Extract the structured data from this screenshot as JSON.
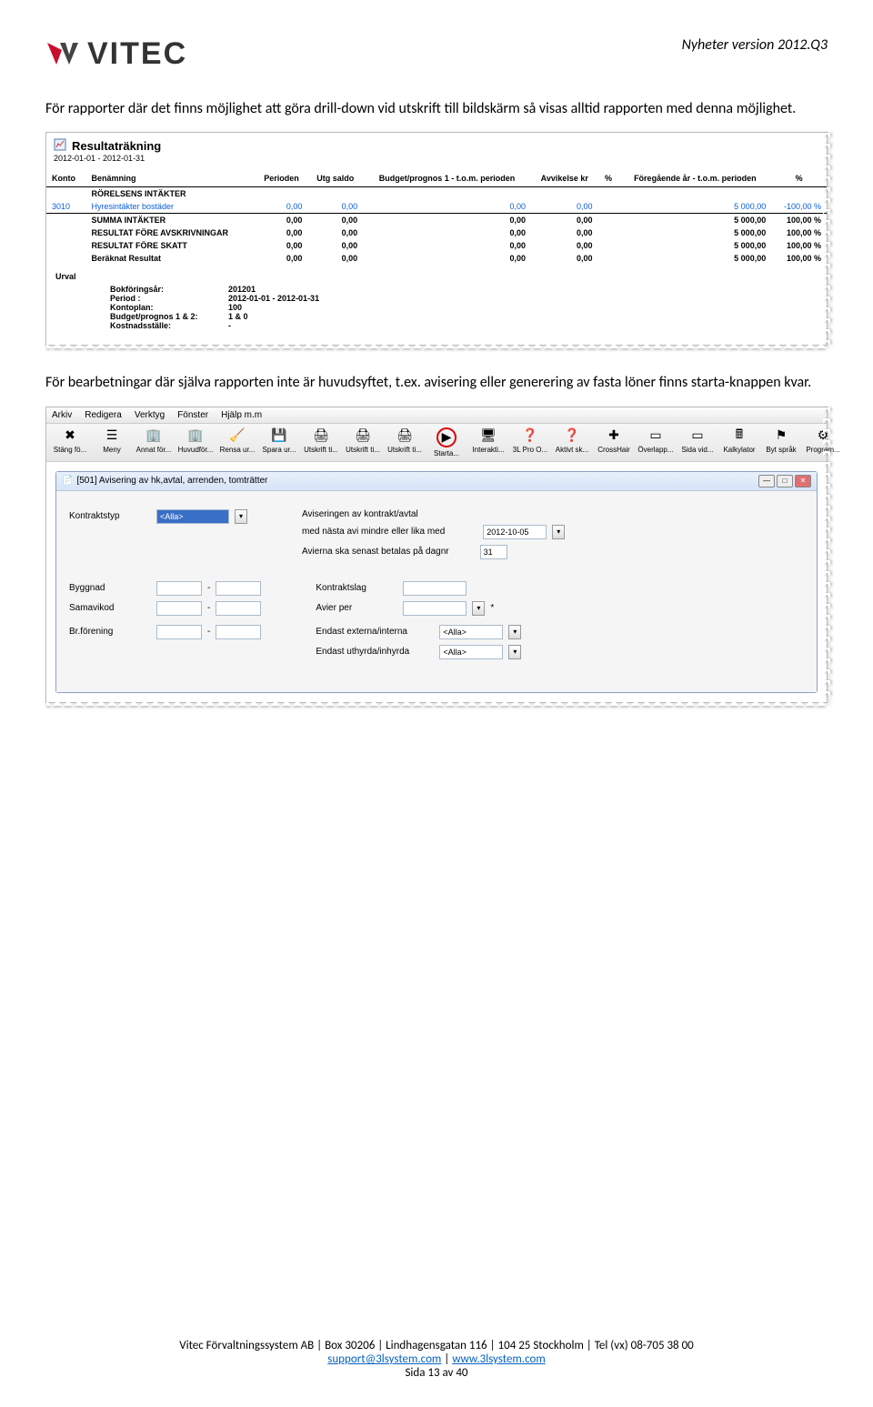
{
  "header": {
    "logo_text": "VITEC",
    "version": "Nyheter version 2012.Q3"
  },
  "para1": "För rapporter där det finns möjlighet att göra drill-down vid utskrift till bildskärm så visas alltid rapporten med denna möjlighet.",
  "para2": "För bearbetningar där själva rapporten inte är huvudsyftet, t.ex. avisering eller generering av fasta löner finns starta-knappen kvar.",
  "report": {
    "title": "Resultaträkning",
    "daterange": "2012-01-01 - 2012-01-31",
    "columns": [
      "Konto",
      "Benämning",
      "Perioden",
      "Utg saldo",
      "Budget/prognos 1 - t.o.m. perioden",
      "Avvikelse kr",
      "%",
      "Föregående år - t.o.m. perioden",
      "%"
    ],
    "section": "RÖRELSENS INTÄKTER",
    "rows": [
      {
        "konto": "3010",
        "ben": "Hyresintäkter bostäder",
        "per": "0,00",
        "utg": "0,00",
        "bud": "0,00",
        "avv": "0,00",
        "pct": "",
        "fg": "5 000,00",
        "fgpct": "-100,00 %",
        "link": true,
        "bold": false
      },
      {
        "konto": "",
        "ben": "SUMMA INTÄKTER",
        "per": "0,00",
        "utg": "0,00",
        "bud": "0,00",
        "avv": "0,00",
        "pct": "",
        "fg": "5 000,00",
        "fgpct": "100,00 %",
        "link": false,
        "bold": true
      },
      {
        "konto": "",
        "ben": "RESULTAT FÖRE AVSKRIVNINGAR",
        "per": "0,00",
        "utg": "0,00",
        "bud": "0,00",
        "avv": "0,00",
        "pct": "",
        "fg": "5 000,00",
        "fgpct": "100,00 %",
        "link": false,
        "bold": true
      },
      {
        "konto": "",
        "ben": "RESULTAT FÖRE SKATT",
        "per": "0,00",
        "utg": "0,00",
        "bud": "0,00",
        "avv": "0,00",
        "pct": "",
        "fg": "5 000,00",
        "fgpct": "100,00 %",
        "link": false,
        "bold": true
      },
      {
        "konto": "",
        "ben": "Beräknat Resultat",
        "per": "0,00",
        "utg": "0,00",
        "bud": "0,00",
        "avv": "0,00",
        "pct": "",
        "fg": "5 000,00",
        "fgpct": "100,00 %",
        "link": false,
        "bold": true
      }
    ],
    "urval_title": "Urval",
    "urval": [
      {
        "label": "Bokföringsår:",
        "value": "201201"
      },
      {
        "label": "Period :",
        "value": "2012-01-01  -  2012-01-31"
      },
      {
        "label": "Kontoplan:",
        "value": "100"
      },
      {
        "label": "Budget/prognos 1 & 2:",
        "value": "1  &  0"
      },
      {
        "label": "Kostnadsställe:",
        "value": "-"
      }
    ]
  },
  "app": {
    "menus": [
      "Arkiv",
      "Redigera",
      "Verktyg",
      "Fönster",
      "Hjälp m.m"
    ],
    "toolbar": [
      {
        "label": "Stäng fö...",
        "icon": "✖",
        "name": "close-icon"
      },
      {
        "label": "Meny",
        "icon": "☰",
        "name": "menu-icon"
      },
      {
        "label": "Annat för...",
        "icon": "🏢",
        "name": "other-icon"
      },
      {
        "label": "Huvudför...",
        "icon": "🏢",
        "name": "main-icon"
      },
      {
        "label": "Rensa ur...",
        "icon": "🧹",
        "name": "clear-icon"
      },
      {
        "label": "Spara ur...",
        "icon": "💾",
        "name": "save-icon"
      },
      {
        "label": "Utskrift ti...",
        "icon": "🖨",
        "name": "print-icon"
      },
      {
        "label": "Utskrift ti...",
        "icon": "🖨",
        "name": "print2-icon"
      },
      {
        "label": "Utskrift ti...",
        "icon": "🖨",
        "name": "print3-icon"
      },
      {
        "label": "Starta...",
        "icon": "▶",
        "name": "start-icon",
        "highlight": true
      },
      {
        "label": "Interakti...",
        "icon": "🖥",
        "name": "interactive-icon"
      },
      {
        "label": "3L Pro O...",
        "icon": "❓",
        "name": "help-icon"
      },
      {
        "label": "Aktivt sk...",
        "icon": "❓",
        "name": "active-icon"
      },
      {
        "label": "CrossHair",
        "icon": "✚",
        "name": "crosshair-icon"
      },
      {
        "label": "Överlapp...",
        "icon": "▭",
        "name": "overlap-icon"
      },
      {
        "label": "Sida vid...",
        "icon": "▭",
        "name": "side-icon"
      },
      {
        "label": "Kalkylator",
        "icon": "🖩",
        "name": "calc-icon"
      },
      {
        "label": "Byt språk",
        "icon": "⚑",
        "name": "lang-icon"
      },
      {
        "label": "Program...",
        "icon": "⚙",
        "name": "prog-icon"
      }
    ],
    "subwin_title": "[501] Avisering av hk,avtal, arrenden, tomträtter",
    "form": {
      "kontraktstyp_label": "Kontraktstyp",
      "kontraktstyp_value": "<Alla>",
      "avis_label1": "Aviseringen av kontrakt/avtal",
      "avis_label2": "med nästa avi mindre eller lika med",
      "avis_date": "2012-10-05",
      "avis_label3": "Avierna ska senast betalas på dagnr",
      "avis_day": "31",
      "byggnad": "Byggnad",
      "samavikod": "Samavikod",
      "brforening": "Br.förening",
      "kontraktslag": "Kontraktslag",
      "avier_per": "Avier per",
      "endast_ext": "Endast externa/interna",
      "endast_uth": "Endast uthyrda/inhyrda",
      "alla": "<Alla>"
    }
  },
  "footer": {
    "line1": "Vitec Förvaltningssystem AB | Box 30206 | Lindhagensgatan 116 | 104 25 Stockholm | Tel (vx) 08-705 38 00",
    "email": "support@3lsystem.com",
    "sep": " | ",
    "url": "www.3lsystem.com",
    "page": "Sida 13 av 40"
  }
}
